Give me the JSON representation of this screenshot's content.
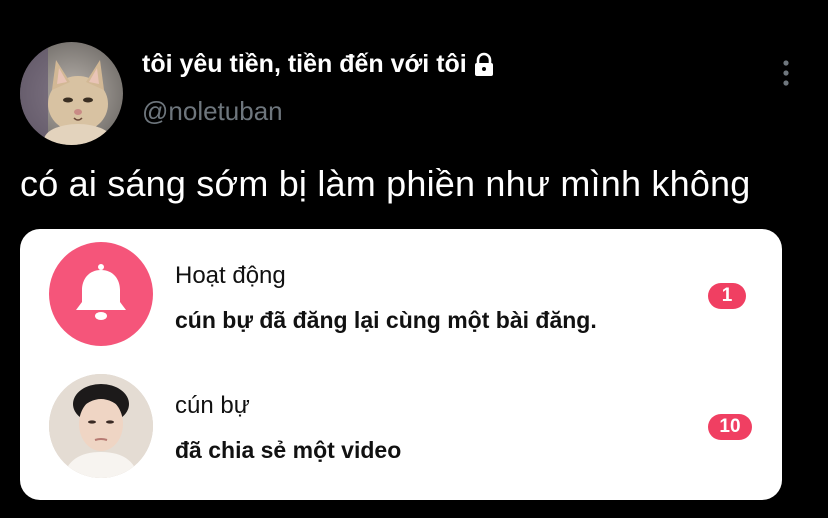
{
  "tweet": {
    "display_name": "tôi yêu tiền, tiền đến với tôi",
    "handle": "@noletuban",
    "text": "có ai sáng sớm bị làm phiền như mình không"
  },
  "card": {
    "notifications": [
      {
        "title": "Hoạt động",
        "subtitle": "cún bự đã đăng lại cùng một bài đăng.",
        "badge": "1",
        "icon": "bell-icon"
      },
      {
        "title": "cún bự",
        "subtitle": "đã chia sẻ một video",
        "badge": "10",
        "icon": "user-avatar"
      }
    ]
  },
  "colors": {
    "background": "#000000",
    "handle": "#6e767d",
    "bell_circle": "#f5557a",
    "badge": "#f03f62",
    "card": "#ffffff"
  }
}
